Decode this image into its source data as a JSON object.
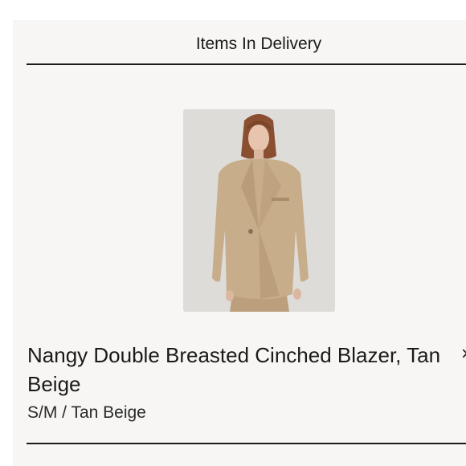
{
  "section": {
    "title": "Items In Delivery"
  },
  "item": {
    "image_icon": "product-photo-blazer",
    "name": "Nangy Double Breasted Cinched Blazer, Tan Beige",
    "variant": "S/M / Tan Beige",
    "remove_glyph": "×"
  },
  "colors": {
    "background": "#f7f6f4",
    "text": "#1a1a1a",
    "blazer": "#c8ad8a"
  }
}
